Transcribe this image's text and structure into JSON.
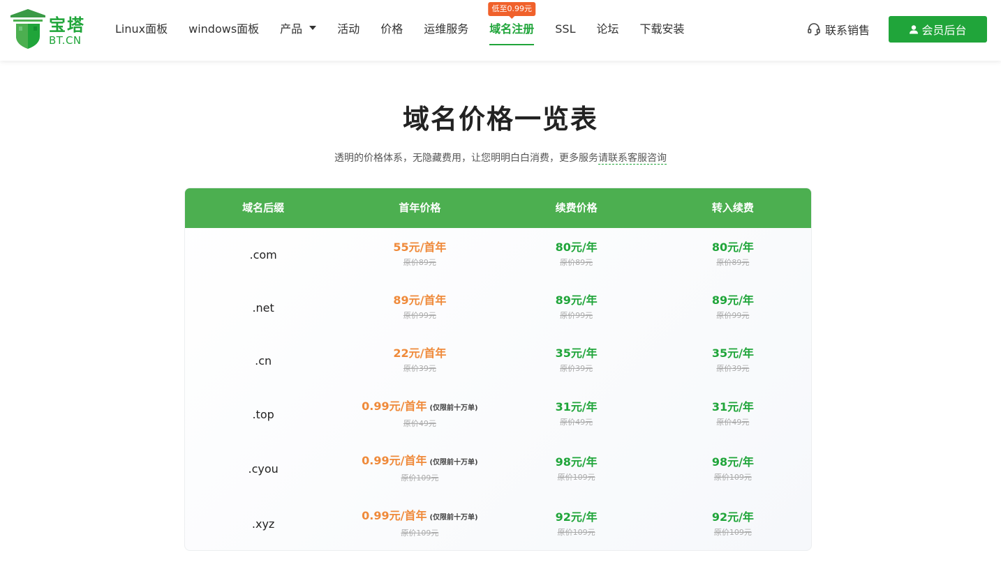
{
  "header": {
    "logo_name": "宝塔",
    "logo_domain": "BT.CN",
    "nav": [
      {
        "label": "Linux面板"
      },
      {
        "label": "windows面板"
      },
      {
        "label": "产品",
        "dropdown": true
      },
      {
        "label": "活动"
      },
      {
        "label": "价格"
      },
      {
        "label": "运维服务"
      },
      {
        "label": "域名注册",
        "active": true,
        "badge": "低至0.99元"
      },
      {
        "label": "SSL"
      },
      {
        "label": "论坛"
      },
      {
        "label": "下载安装"
      }
    ],
    "contact_label": "联系销售",
    "member_label": "会员后台"
  },
  "main": {
    "title": "域名价格一览表",
    "subtitle_text": "透明的价格体系，无隐藏费用，让您明明白白消费，更多服务",
    "subtitle_link": "请联系客服咨询"
  },
  "table": {
    "headers": [
      "域名后缀",
      "首年价格",
      "续费价格",
      "转入续费"
    ],
    "rows": [
      {
        "suffix": ".com",
        "first": "55元/首年",
        "first_note": "",
        "first_orig": "原价89元",
        "renew": "80元/年",
        "renew_orig": "原价89元",
        "transfer": "80元/年",
        "transfer_orig": "原价89元"
      },
      {
        "suffix": ".net",
        "first": "89元/首年",
        "first_note": "",
        "first_orig": "原价99元",
        "renew": "89元/年",
        "renew_orig": "原价99元",
        "transfer": "89元/年",
        "transfer_orig": "原价99元"
      },
      {
        "suffix": ".cn",
        "first": "22元/首年",
        "first_note": "",
        "first_orig": "原价39元",
        "renew": "35元/年",
        "renew_orig": "原价39元",
        "transfer": "35元/年",
        "transfer_orig": "原价39元"
      },
      {
        "suffix": ".top",
        "first": "0.99元/首年",
        "first_note": "(仅限前十万单)",
        "first_orig": "原价49元",
        "renew": "31元/年",
        "renew_orig": "原价49元",
        "transfer": "31元/年",
        "transfer_orig": "原价49元"
      },
      {
        "suffix": ".cyou",
        "first": "0.99元/首年",
        "first_note": "(仅限前十万单)",
        "first_orig": "原价109元",
        "renew": "98元/年",
        "renew_orig": "原价109元",
        "transfer": "98元/年",
        "transfer_orig": "原价109元"
      },
      {
        "suffix": ".xyz",
        "first": "0.99元/首年",
        "first_note": "(仅限前十万单)",
        "first_orig": "原价109元",
        "renew": "92元/年",
        "renew_orig": "原价109元",
        "transfer": "92元/年",
        "transfer_orig": "原价109元"
      }
    ]
  },
  "colors": {
    "brand_green": "#20a53a",
    "table_header_green": "#4caf50",
    "promo_orange": "#f0612b",
    "first_price_orange": "#ef8a3a"
  },
  "icons": {
    "logo": "pagoda-shield-icon",
    "contact": "headset-icon",
    "member": "user-icon",
    "dropdown": "caret-down-icon"
  }
}
